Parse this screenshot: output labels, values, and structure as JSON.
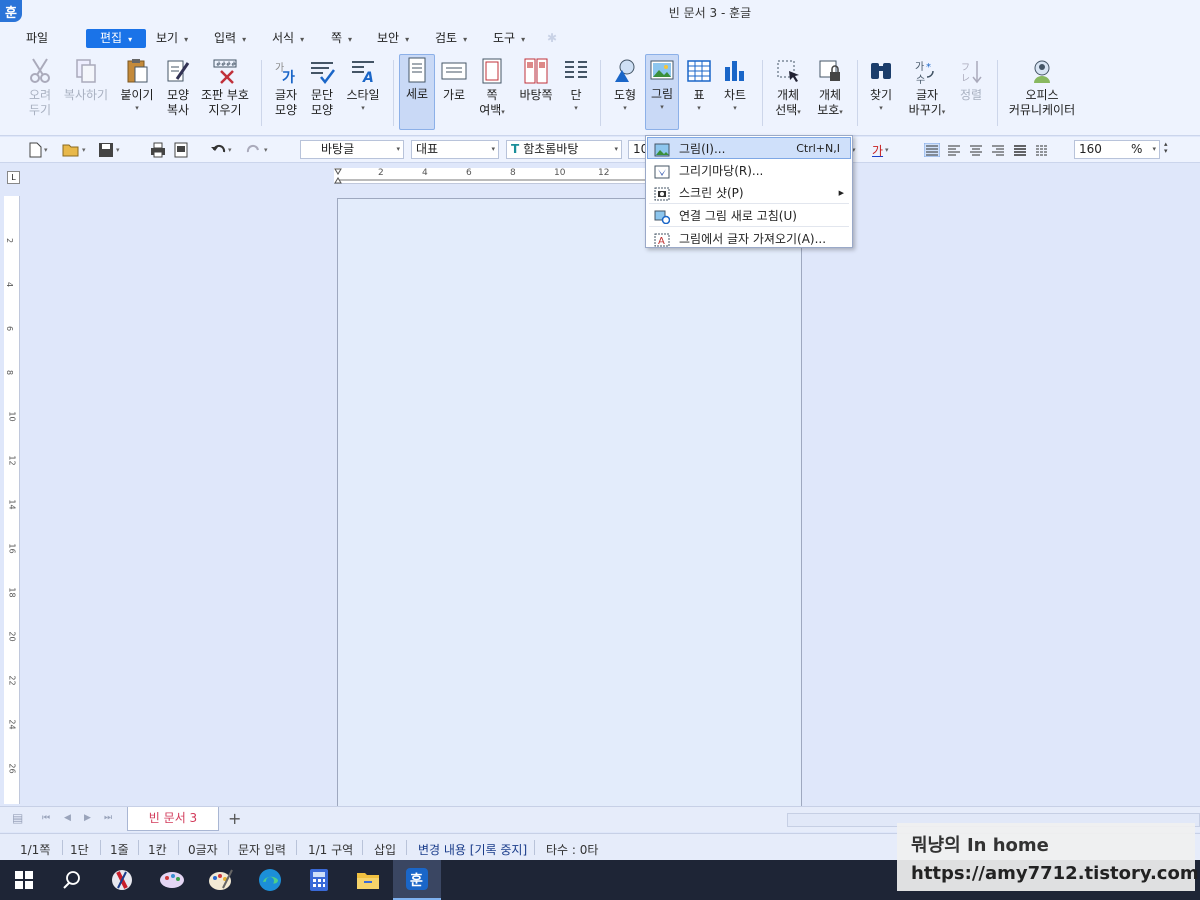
{
  "app": {
    "logo_glyph": "훈",
    "title": "빈 문서 3 - 훈글"
  },
  "menu": [
    {
      "label": "파일",
      "arrow": ""
    },
    {
      "label": "편집",
      "arrow": "▾"
    },
    {
      "label": "보기",
      "arrow": "▾"
    },
    {
      "label": "입력",
      "arrow": "▾"
    },
    {
      "label": "서식",
      "arrow": "▾"
    },
    {
      "label": "쪽",
      "arrow": "▾"
    },
    {
      "label": "보안",
      "arrow": "▾"
    },
    {
      "label": "검토",
      "arrow": "▾"
    },
    {
      "label": "도구",
      "arrow": "▾"
    }
  ],
  "ribbon": {
    "cut": {
      "line1": "오려",
      "line2": "두기"
    },
    "copy": {
      "line1": "복사하기",
      "line2": ""
    },
    "paste": {
      "line1": "붙이기",
      "line2": ""
    },
    "format_copy": {
      "line1": "모양",
      "line2": "복사"
    },
    "clear_marks": {
      "line1": "조판 부호",
      "line2": "지우기"
    },
    "char_shape": {
      "line1": "글자",
      "line2": "모양"
    },
    "para_shape": {
      "line1": "문단",
      "line2": "모양"
    },
    "style": {
      "line1": "스타일",
      "line2": ""
    },
    "portrait": {
      "line1": "세로",
      "line2": ""
    },
    "landscape": {
      "line1": "가로",
      "line2": ""
    },
    "page_margin": {
      "line1": "쪽",
      "line2": "여백"
    },
    "master_page": {
      "line1": "바탕쪽",
      "line2": ""
    },
    "columns": {
      "line1": "단",
      "line2": ""
    },
    "shape": {
      "line1": "도형",
      "line2": ""
    },
    "picture": {
      "line1": "그림",
      "line2": ""
    },
    "table": {
      "line1": "표",
      "line2": ""
    },
    "chart": {
      "line1": "차트",
      "line2": ""
    },
    "object_select": {
      "line1": "개체",
      "line2": "선택"
    },
    "object_protect": {
      "line1": "개체",
      "line2": "보호"
    },
    "find": {
      "line1": "찾기",
      "line2": ""
    },
    "replace": {
      "line1": "글자",
      "line2": "바꾸기"
    },
    "sort": {
      "line1": "정렬",
      "line2": ""
    },
    "office_comm": {
      "line1": "오피스",
      "line2": "커뮤니케이터"
    }
  },
  "toolbar2": {
    "style_combo": "바탕글",
    "lang_combo": "대표",
    "font_combo": "함초롬바탕",
    "size_combo": "10",
    "text_color_glyph": "가",
    "zoom_value": "160",
    "zoom_unit": "%"
  },
  "ruler_marks": [
    "2",
    "4",
    "6",
    "8",
    "10",
    "12"
  ],
  "vruler_marks": [
    "2",
    "4",
    "6",
    "8",
    "10",
    "12",
    "14",
    "16",
    "18",
    "20",
    "22",
    "24",
    "26"
  ],
  "picture_menu": [
    {
      "label": "그림(I)...",
      "shortcut": "Ctrl+N,I"
    },
    {
      "label": "그리기마당(R)...",
      "shortcut": ""
    },
    {
      "label": "스크린 샷(P)",
      "shortcut": ""
    },
    {
      "label": "연결 그림 새로 고침(U)",
      "shortcut": ""
    },
    {
      "label": "그림에서 글자 가져오기(A)...",
      "shortcut": ""
    }
  ],
  "doc_tab": "빈 문서 3",
  "status": [
    "1/1쪽",
    "1단",
    "1줄",
    "1칸",
    "0글자",
    "문자 입력",
    "1/1 구역",
    "삽입",
    "변경 내용 [기록 중지]",
    "타수 : 0타"
  ],
  "watermark": {
    "line1": "뭐냥의 In home",
    "line2": "https://amy7712.tistory.com"
  }
}
